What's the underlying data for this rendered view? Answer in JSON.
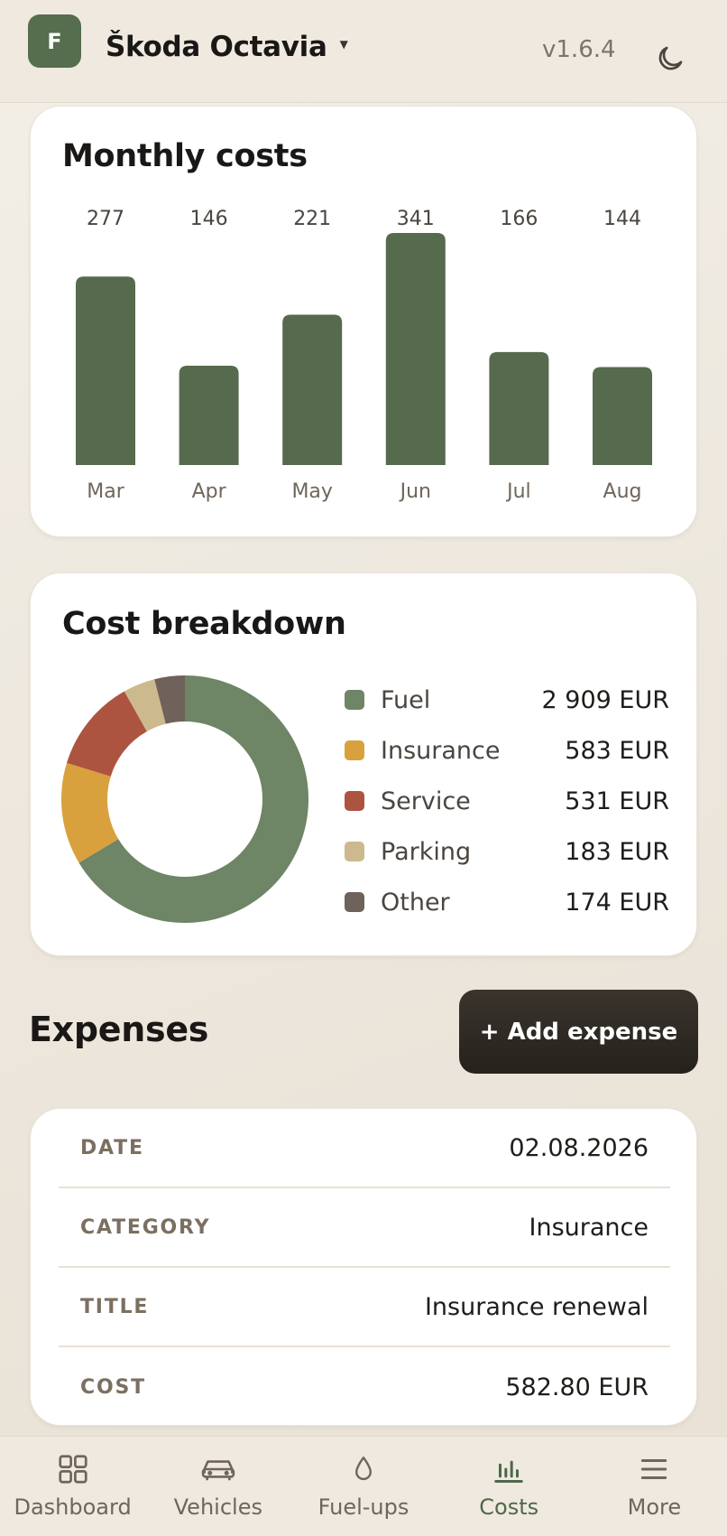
{
  "header": {
    "badge_letter": "F",
    "vehicle": "Škoda Octavia",
    "version": "v1.6.4"
  },
  "monthly": {
    "title": "Monthly costs"
  },
  "breakdown": {
    "title": "Cost breakdown",
    "items": [
      {
        "label": "Fuel",
        "value": "2 909 EUR",
        "color": "#6e8566"
      },
      {
        "label": "Insurance",
        "value": "583 EUR",
        "color": "#d9a13e"
      },
      {
        "label": "Service",
        "value": "531 EUR",
        "color": "#ad5440"
      },
      {
        "label": "Parking",
        "value": "183 EUR",
        "color": "#cdb98e"
      },
      {
        "label": "Other",
        "value": "174 EUR",
        "color": "#6f625a"
      }
    ]
  },
  "expenses": {
    "title": "Expenses",
    "add_label": "+ Add expense",
    "rows": [
      {
        "key": "DATE",
        "value": "02.08.2026"
      },
      {
        "key": "CATEGORY",
        "value": "Insurance"
      },
      {
        "key": "TITLE",
        "value": "Insurance renewal"
      },
      {
        "key": "COST",
        "value": "582.80 EUR"
      }
    ]
  },
  "nav": {
    "items": [
      {
        "label": "Dashboard",
        "icon": "grid-icon"
      },
      {
        "label": "Vehicles",
        "icon": "car-icon"
      },
      {
        "label": "Fuel-ups",
        "icon": "droplet-icon"
      },
      {
        "label": "Costs",
        "icon": "bar-chart-icon"
      },
      {
        "label": "More",
        "icon": "menu-icon"
      }
    ],
    "active": "Costs"
  },
  "colors": {
    "accent": "#566d4e",
    "bar": "#566a4d",
    "dark_button": "#2b2620"
  },
  "chart_data": [
    {
      "type": "bar",
      "categories": [
        "Mar",
        "Apr",
        "May",
        "Jun",
        "Jul",
        "Aug"
      ],
      "values": [
        277,
        146,
        221,
        341,
        166,
        144
      ],
      "title": "Monthly costs",
      "ylim": [
        0,
        341
      ],
      "grid": false
    },
    {
      "type": "pie",
      "categories": [
        "Fuel",
        "Insurance",
        "Service",
        "Parking",
        "Other"
      ],
      "values": [
        2909,
        583,
        531,
        183,
        174
      ],
      "title": "Cost breakdown",
      "legend": "right",
      "donut": true
    }
  ]
}
